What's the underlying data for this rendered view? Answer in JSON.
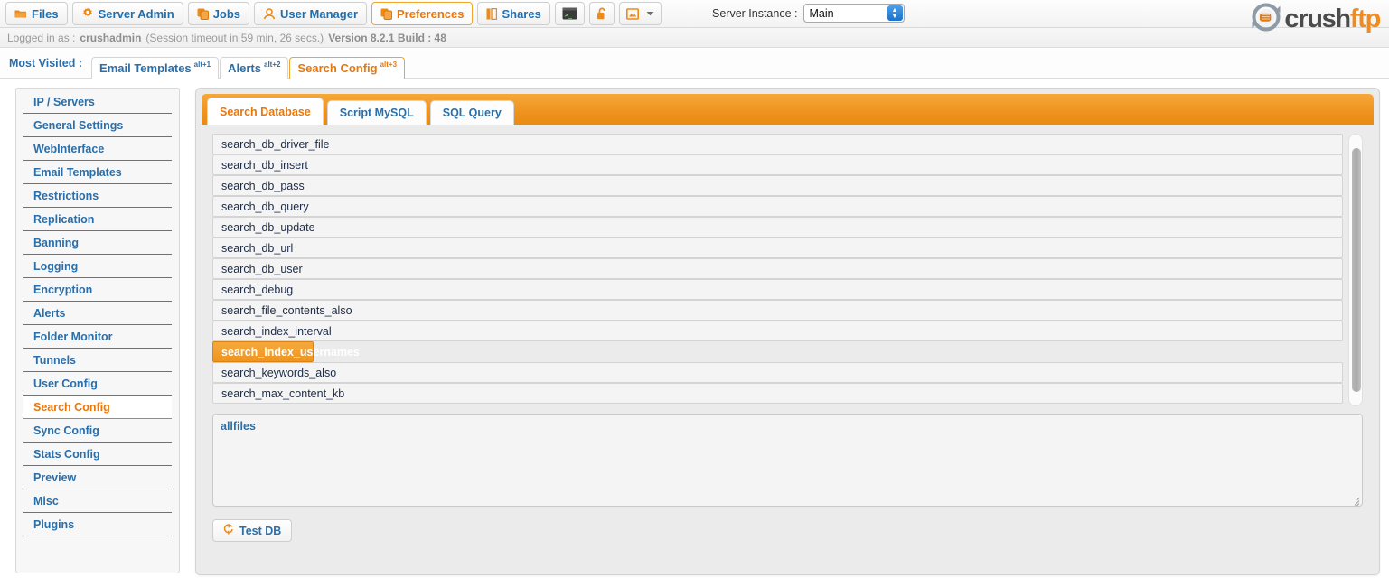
{
  "toolbar": {
    "buttons": [
      {
        "label": "Files",
        "icon": "folder-icon",
        "active": false
      },
      {
        "label": "Server Admin",
        "icon": "gear-icon",
        "active": false
      },
      {
        "label": "Jobs",
        "icon": "jobs-icon",
        "active": false
      },
      {
        "label": "User Manager",
        "icon": "user-icon",
        "active": false
      },
      {
        "label": "Preferences",
        "icon": "preferences-icon",
        "active": true
      },
      {
        "label": "Shares",
        "icon": "shares-icon",
        "active": false
      }
    ],
    "icon_buttons": [
      {
        "name": "terminal-icon"
      },
      {
        "name": "lock-icon"
      },
      {
        "name": "image-dropdown-icon"
      }
    ],
    "instance_label": "Server Instance :",
    "instance_value": "Main",
    "instance_options": [
      "Main"
    ]
  },
  "logo": {
    "part1": "crush",
    "part2": "ftp"
  },
  "session": {
    "logged_in_label": "Logged in as :",
    "user": "crushadmin",
    "timeout": "(Session timeout in 59 min, 26 secs.)",
    "version": "Version 8.2.1 Build : 48"
  },
  "most_visited": {
    "label": "Most Visited :",
    "tabs": [
      {
        "label": "Email Templates",
        "shortcut": "alt+1",
        "active": false
      },
      {
        "label": "Alerts",
        "shortcut": "alt+2",
        "active": false
      },
      {
        "label": "Search Config",
        "shortcut": "alt+3",
        "active": true
      }
    ]
  },
  "sidebar": {
    "items": [
      {
        "label": "IP / Servers",
        "active": false
      },
      {
        "label": "General Settings",
        "active": false
      },
      {
        "label": "WebInterface",
        "active": false
      },
      {
        "label": "Email Templates",
        "active": false
      },
      {
        "label": "Restrictions",
        "active": false
      },
      {
        "label": "Replication",
        "active": false
      },
      {
        "label": "Banning",
        "active": false
      },
      {
        "label": "Logging",
        "active": false
      },
      {
        "label": "Encryption",
        "active": false
      },
      {
        "label": "Alerts",
        "active": false
      },
      {
        "label": "Folder Monitor",
        "active": false
      },
      {
        "label": "Tunnels",
        "active": false
      },
      {
        "label": "User Config",
        "active": false
      },
      {
        "label": "Search Config",
        "active": true
      },
      {
        "label": "Sync Config",
        "active": false
      },
      {
        "label": "Stats Config",
        "active": false
      },
      {
        "label": "Preview",
        "active": false
      },
      {
        "label": "Misc",
        "active": false
      },
      {
        "label": "Plugins",
        "active": false
      }
    ]
  },
  "main": {
    "tabs": [
      {
        "label": "Search Database",
        "active": true
      },
      {
        "label": "Script MySQL",
        "active": false
      },
      {
        "label": "SQL Query",
        "active": false
      }
    ],
    "settings_list": [
      {
        "key": "search_db_driver_file",
        "selected": false
      },
      {
        "key": "search_db_insert",
        "selected": false
      },
      {
        "key": "search_db_pass",
        "selected": false
      },
      {
        "key": "search_db_query",
        "selected": false
      },
      {
        "key": "search_db_update",
        "selected": false
      },
      {
        "key": "search_db_url",
        "selected": false
      },
      {
        "key": "search_db_user",
        "selected": false
      },
      {
        "key": "search_debug",
        "selected": false
      },
      {
        "key": "search_file_contents_also",
        "selected": false
      },
      {
        "key": "search_index_interval",
        "selected": false
      },
      {
        "key": "search_index_usernames",
        "selected": true
      },
      {
        "key": "search_keywords_also",
        "selected": false
      },
      {
        "key": "search_max_content_kb",
        "selected": false
      }
    ],
    "value_editor": {
      "value": "allfiles",
      "placeholder": ""
    },
    "test_button": {
      "label": "Test DB",
      "icon": "refresh-icon"
    }
  },
  "colors": {
    "accent_orange": "#e8770c",
    "link_blue": "#2b6ea8",
    "selected_row": "#ef9520"
  }
}
